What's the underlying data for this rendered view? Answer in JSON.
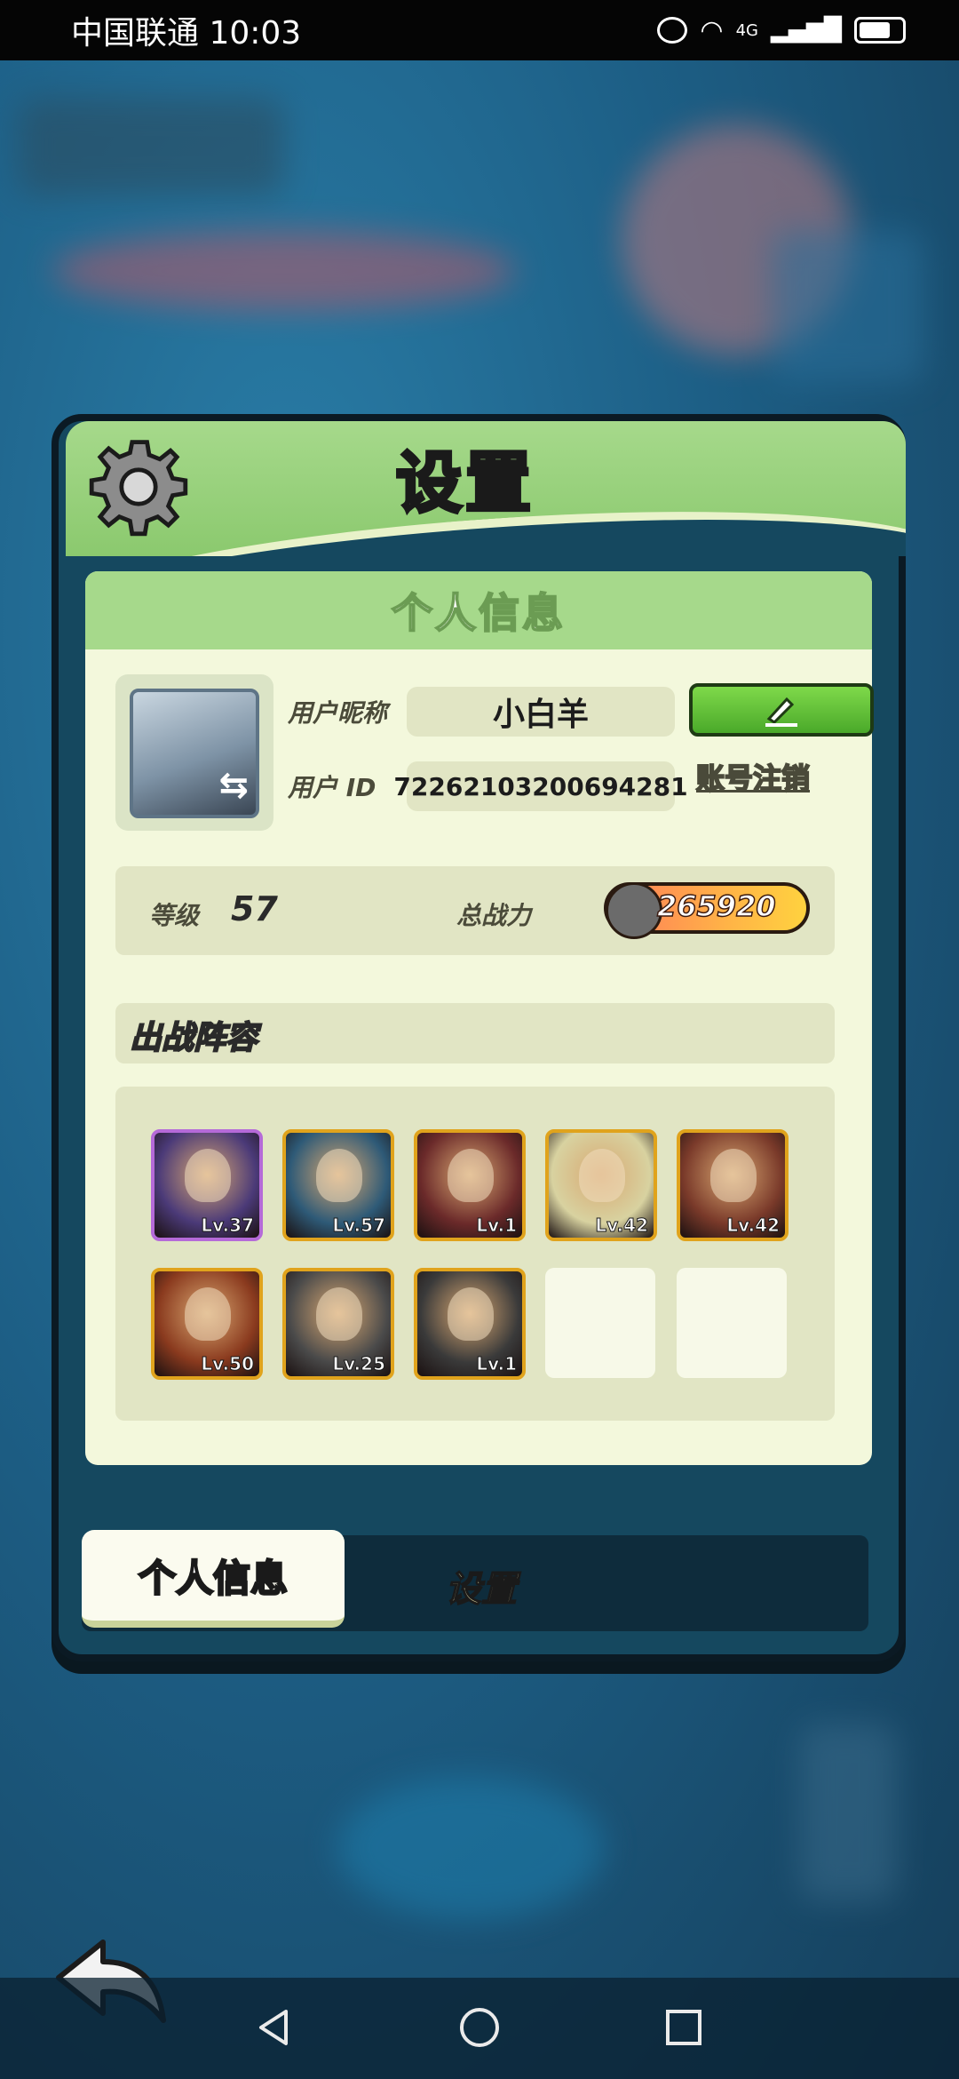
{
  "status_bar": {
    "carrier_time": "中国联通 10:03",
    "network": "4G"
  },
  "dialog": {
    "title": "设置",
    "section_title": "个人信息",
    "profile": {
      "nickname_label": "用户昵称",
      "nickname": "小白羊",
      "id_label": "用户 ID",
      "user_id": "72262103200694281",
      "account_cancel_label": "账号注销"
    },
    "stats": {
      "level_label": "等级",
      "level": "57",
      "power_label": "总战力",
      "power": "265920"
    },
    "lineup": {
      "title": "出战阵容",
      "heroes": [
        {
          "level": "Lv.37",
          "rarity": "purple",
          "color": "#4b3a78"
        },
        {
          "level": "Lv.57",
          "rarity": "gold",
          "color": "#2e5a77"
        },
        {
          "level": "Lv.1",
          "rarity": "gold",
          "color": "#6b2a2a"
        },
        {
          "level": "Lv.42",
          "rarity": "gold",
          "color": "#d8d2a0"
        },
        {
          "level": "Lv.42",
          "rarity": "gold",
          "color": "#7a3a2a"
        },
        {
          "level": "Lv.50",
          "rarity": "gold",
          "color": "#8a3a1e"
        },
        {
          "level": "Lv.25",
          "rarity": "gold",
          "color": "#4a4a4a"
        },
        {
          "level": "Lv.1",
          "rarity": "gold",
          "color": "#3a3a3a"
        }
      ],
      "empty_slots": 2
    },
    "tabs": {
      "active": "个人信息",
      "inactive": "设置"
    }
  }
}
